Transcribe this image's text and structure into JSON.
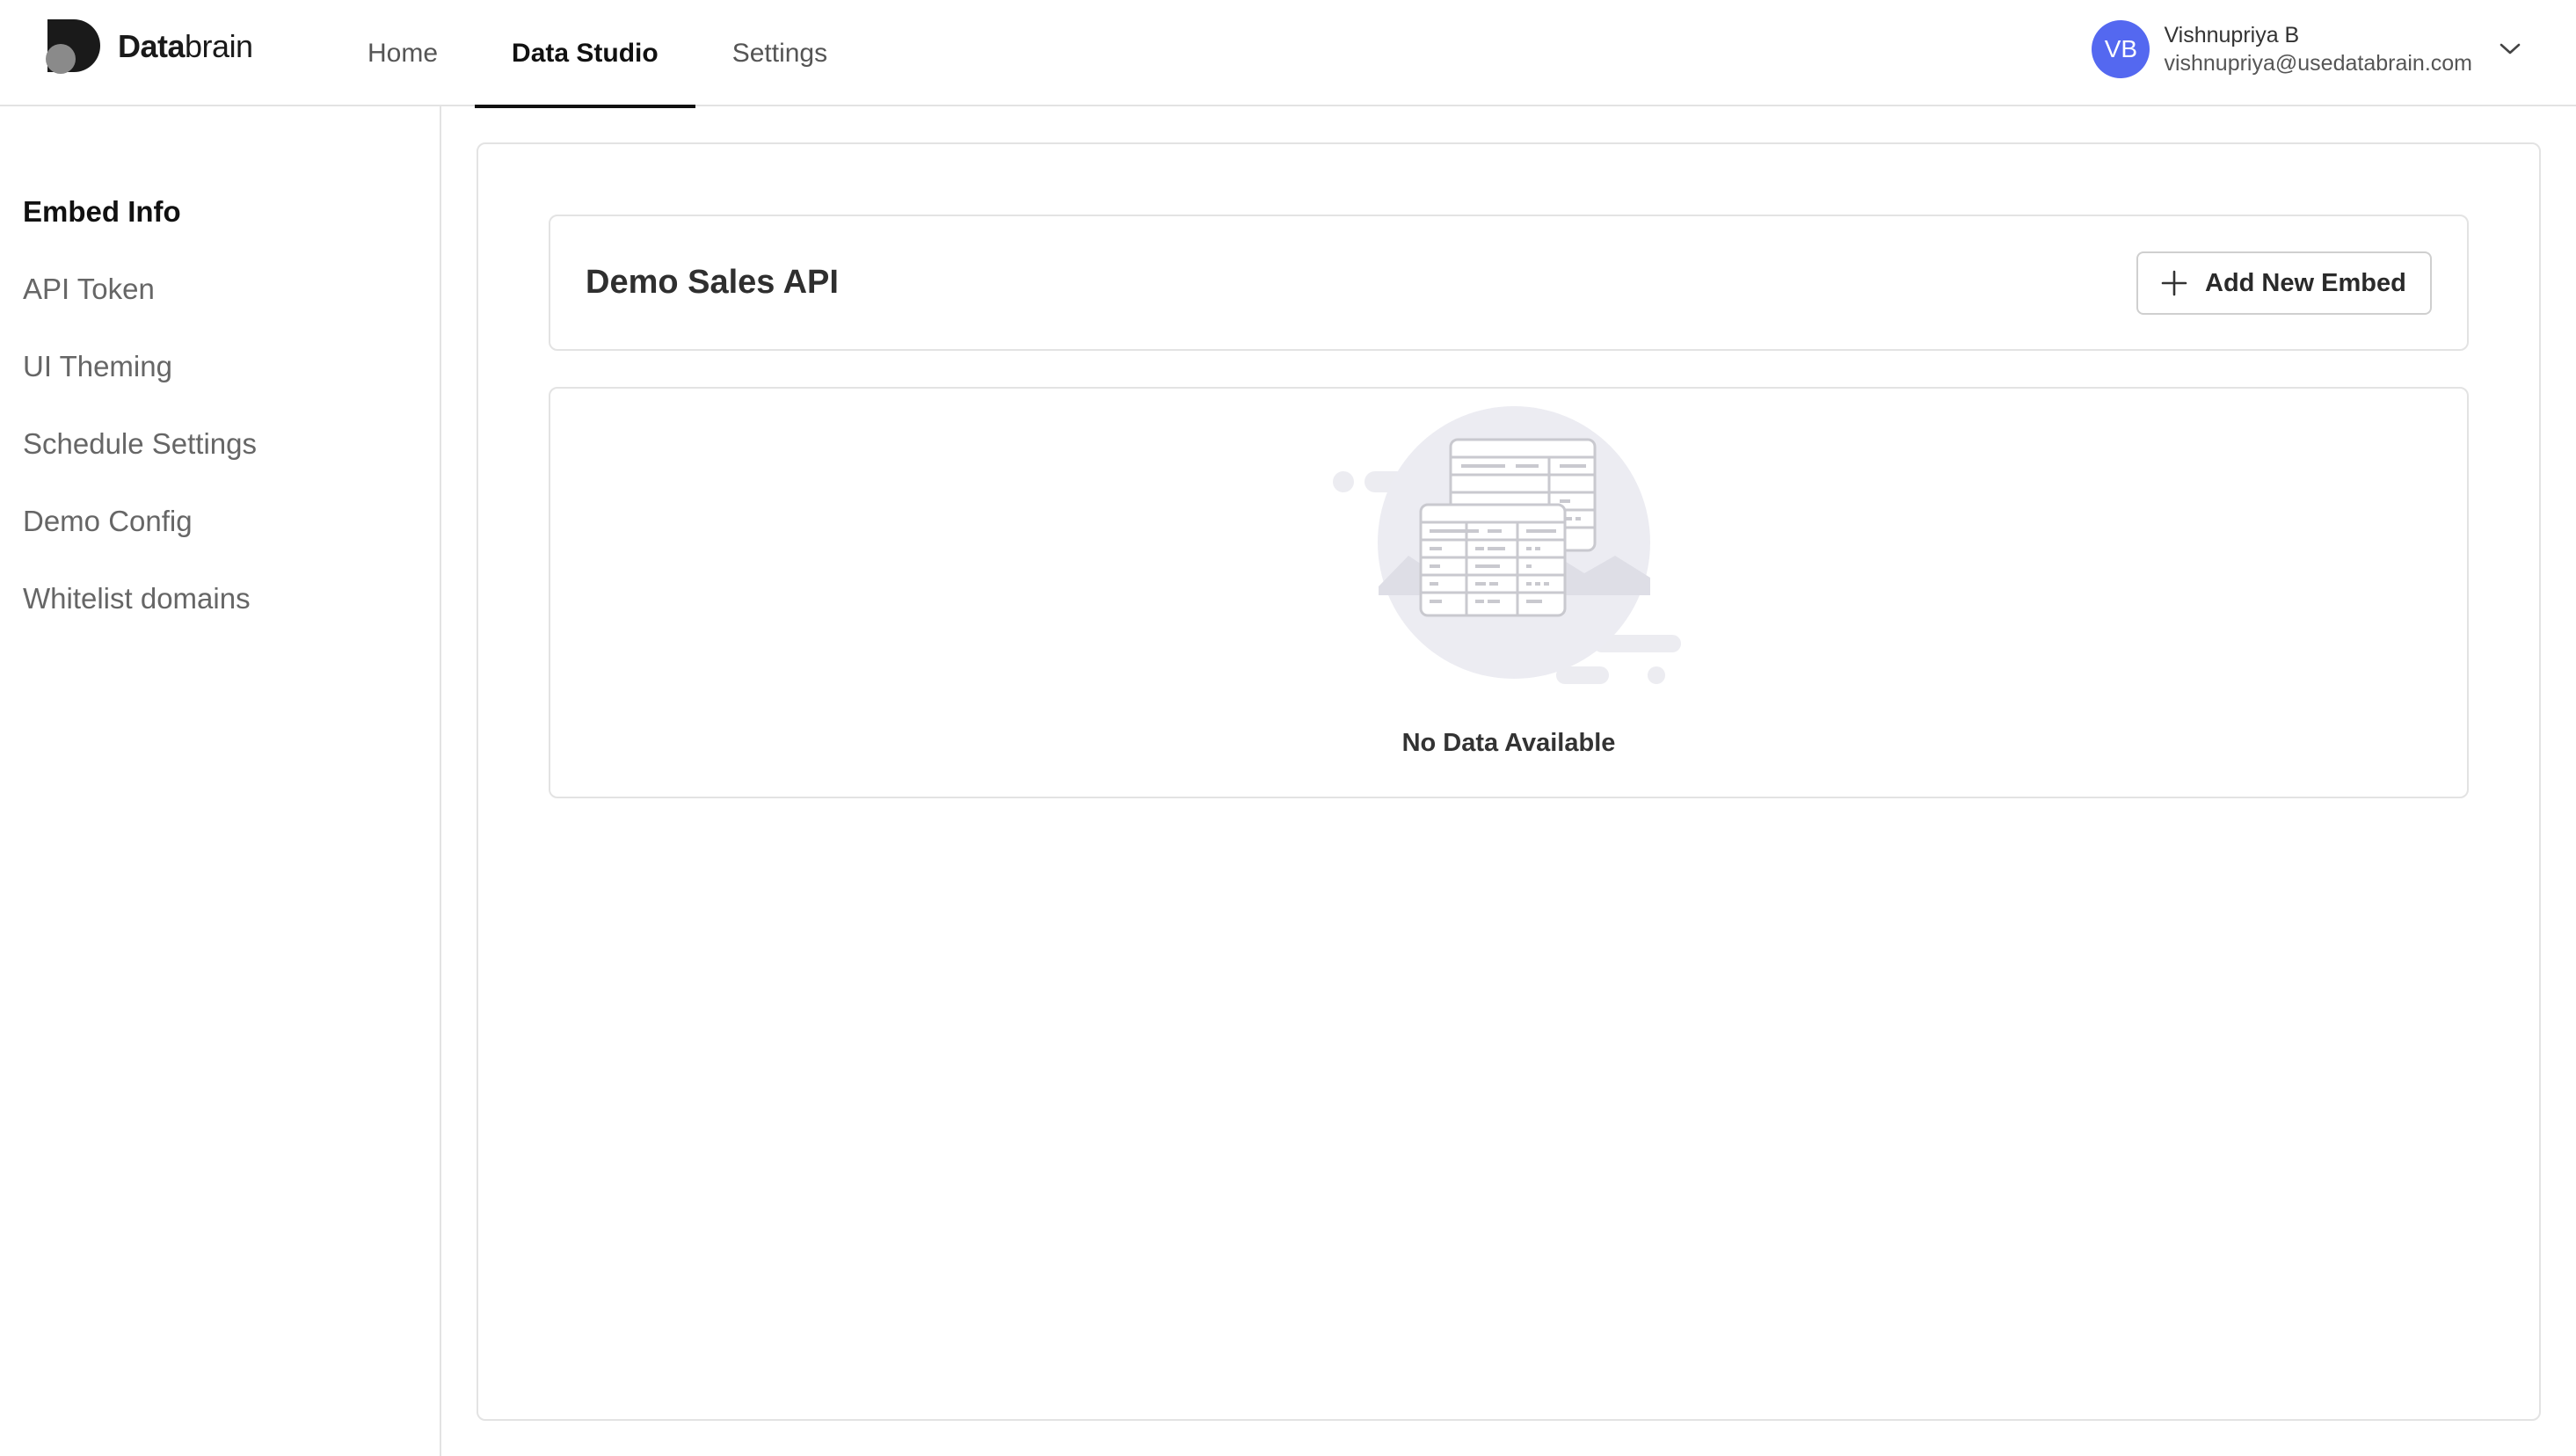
{
  "brand": {
    "name_bold": "Data",
    "name_rest": "brain"
  },
  "nav": {
    "tabs": [
      {
        "label": "Home",
        "active": false
      },
      {
        "label": "Data Studio",
        "active": true
      },
      {
        "label": "Settings",
        "active": false
      }
    ]
  },
  "user": {
    "initials": "VB",
    "name": "Vishnupriya B",
    "email": "vishnupriya@usedatabrain.com",
    "avatar_color": "#5468f0"
  },
  "sidebar": {
    "items": [
      {
        "label": "Embed Info",
        "active": true
      },
      {
        "label": "API Token",
        "active": false
      },
      {
        "label": "UI Theming",
        "active": false
      },
      {
        "label": "Schedule Settings",
        "active": false
      },
      {
        "label": "Demo Config",
        "active": false
      },
      {
        "label": "Whitelist domains",
        "active": false
      }
    ]
  },
  "main": {
    "title": "Demo Sales API",
    "add_button_label": "Add New Embed",
    "empty_state": {
      "message": "No Data Available",
      "icon": "empty-table-illustration"
    }
  },
  "icons": {
    "dropdown": "chevron-down-icon",
    "add": "plus-icon"
  }
}
